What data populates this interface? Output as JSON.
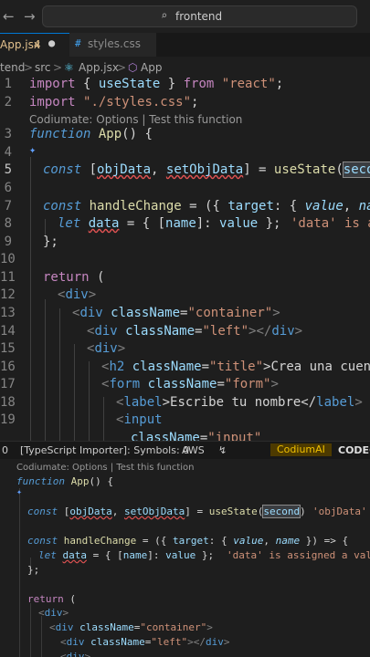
{
  "titlebar": {
    "search_text": "frontend",
    "search_icon": "search-icon",
    "nav": [
      "back-arrow-icon",
      "forward-arrow-icon"
    ]
  },
  "tabs": [
    {
      "label": "App.jsx",
      "badge": "4",
      "dirty": "●"
    },
    {
      "label": "styles.css",
      "icon": "css-icon"
    }
  ],
  "breadcrumb": {
    "items": [
      "tend",
      "src",
      "App.jsx",
      "App"
    ],
    "separator": ">"
  },
  "codelens": "Codiumate: Options | Test this function",
  "line_numbers": [
    "1",
    "2",
    "",
    "3",
    "4",
    "5",
    "6",
    "7",
    "8",
    "9",
    "10",
    "11",
    "12",
    "13",
    "14",
    "15",
    "16",
    "17",
    "18",
    "19"
  ],
  "code": {
    "l1": [
      "import",
      " { ",
      "useState",
      " } ",
      "from",
      " ",
      "\"react\"",
      ";"
    ],
    "l2": [
      "import",
      " ",
      "\"./styles.css\"",
      ";"
    ],
    "l3": [
      "function",
      " ",
      "App",
      "() {"
    ],
    "l5": [
      "const",
      " [",
      "objData",
      ", ",
      "setObjData",
      "] = ",
      "useState",
      "(",
      "second",
      ")"
    ],
    "l7": [
      "const",
      " ",
      "handleChange",
      " = ({ ",
      "target",
      ": { ",
      "value",
      ", ",
      "name",
      " }"
    ],
    "l8": [
      "let",
      " ",
      "data",
      " = { [",
      "name",
      "]: ",
      "value",
      " };"
    ],
    "l8_hint": "'data' is as",
    "l9": "};",
    "l11": [
      "return",
      " ("
    ],
    "l12": [
      "<",
      "div",
      ">"
    ],
    "l13": [
      "<",
      "div",
      " ",
      "className",
      "=",
      "\"container\"",
      ">"
    ],
    "l14": [
      "<",
      "div",
      " ",
      "className",
      "=",
      "\"left\"",
      "></",
      "div",
      ">"
    ],
    "l15": [
      "<",
      "div",
      ">"
    ],
    "l16": [
      "<",
      "h2",
      " ",
      "className",
      "=",
      "\"title\"",
      ">Crea una cuenta</"
    ],
    "l17": [
      "<",
      "form",
      " ",
      "className",
      "=",
      "\"form\"",
      ">"
    ],
    "l18": [
      "<",
      "label",
      ">Escribe tu nombre</",
      "label",
      ">"
    ],
    "l19": [
      "<",
      "input"
    ],
    "l20": [
      "className",
      "=",
      "\"input\""
    ]
  },
  "statusbar": {
    "col": "0",
    "importer": "[TypeScript Importer]: Symbols: 0",
    "aws": "AWS",
    "branch_icon": "git-icon",
    "codium": "CodiumAI",
    "codegpt": "CODEG"
  },
  "zoom": {
    "l5_hint": "'objData' i",
    "l8_hint": "'data' is assigned a value"
  }
}
